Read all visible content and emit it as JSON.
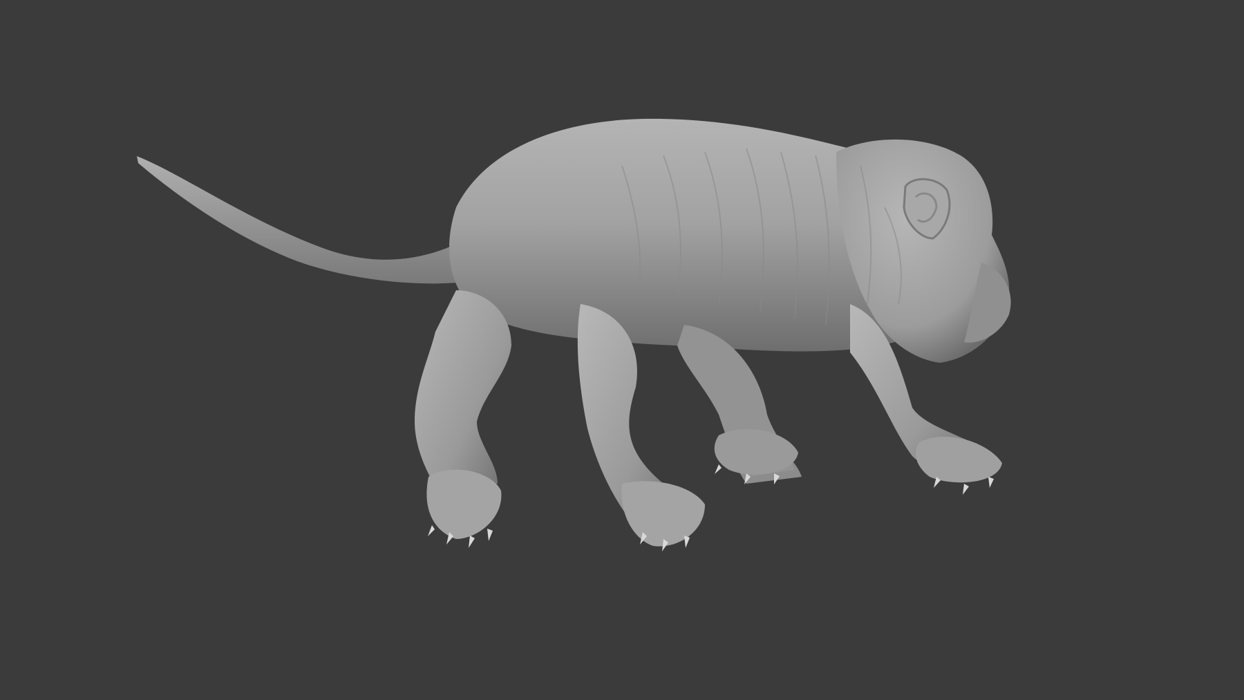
{
  "viewport": {
    "background_color": "#3b3b3b",
    "model_color": "#9a9a9a",
    "subject": "sculpt-model"
  }
}
